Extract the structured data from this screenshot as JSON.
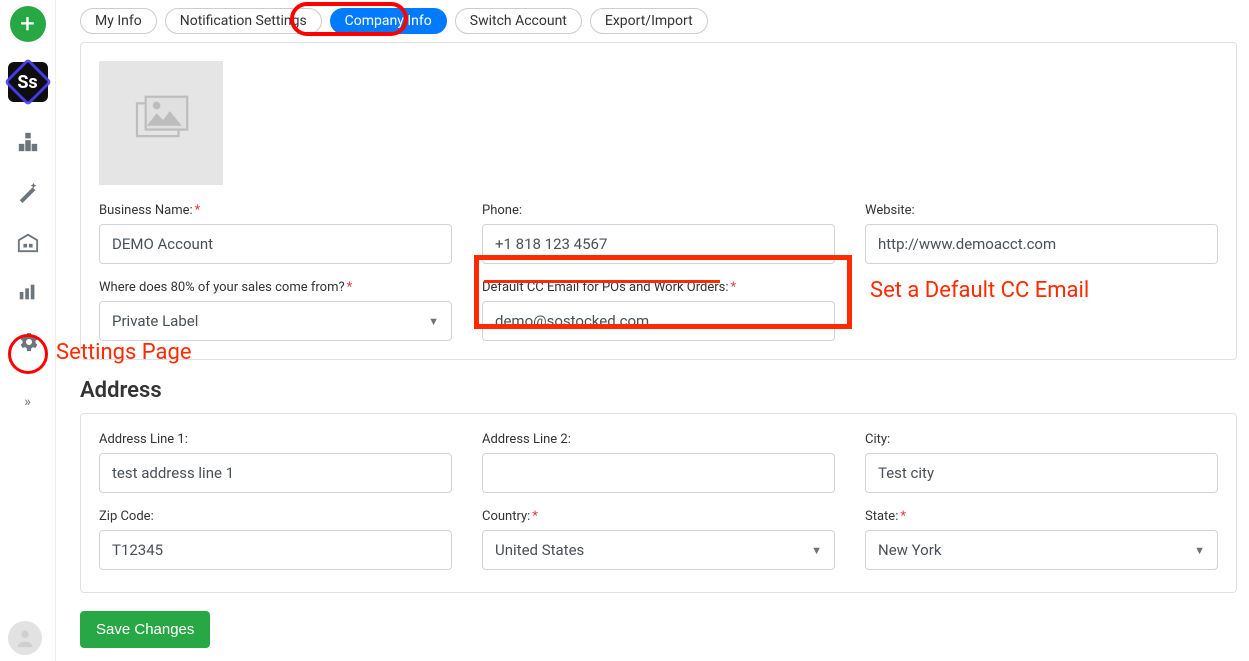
{
  "sidebar": {
    "fab_label": "+",
    "logo_text": "Ss"
  },
  "tabs": [
    {
      "label": "My Info",
      "active": false
    },
    {
      "label": "Notification Settings",
      "active": false
    },
    {
      "label": "Company Info",
      "active": true
    },
    {
      "label": "Switch Account",
      "active": false
    },
    {
      "label": "Export/Import",
      "active": false
    }
  ],
  "company": {
    "business_name_label": "Business Name:",
    "business_name_value": "DEMO Account",
    "phone_label": "Phone:",
    "phone_value": "+1 818 123 4567",
    "website_label": "Website:",
    "website_value": "http://www.demoacct.com",
    "sales_source_label": "Where does 80% of your sales come from?",
    "sales_source_value": "Private Label",
    "cc_email_label": "Default CC Email for POs and Work Orders:",
    "cc_email_value": "demo@sostocked.com"
  },
  "address": {
    "heading": "Address",
    "line1_label": "Address Line 1:",
    "line1_value": "test address line 1",
    "line2_label": "Address Line 2:",
    "line2_value": "",
    "city_label": "City:",
    "city_value": "Test city",
    "zip_label": "Zip Code:",
    "zip_value": "T12345",
    "country_label": "Country:",
    "country_value": "United States",
    "state_label": "State:",
    "state_value": "New York"
  },
  "buttons": {
    "save": "Save Changes"
  },
  "annotations": {
    "settings_label": "Settings Page",
    "cc_label": "Set a Default CC Email"
  }
}
